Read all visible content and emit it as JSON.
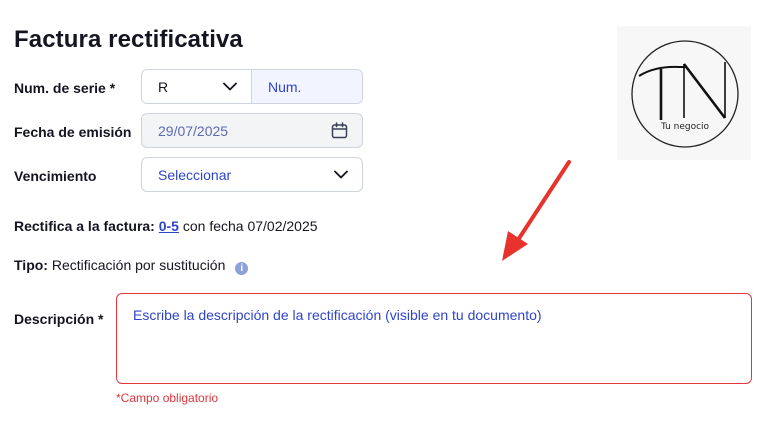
{
  "page": {
    "title": "Factura rectificativa"
  },
  "form": {
    "serie": {
      "label": "Num. de serie *",
      "selected": "R",
      "num_placeholder": "Num."
    },
    "fecha": {
      "label": "Fecha de emisión",
      "value": "29/07/2025"
    },
    "vencimiento": {
      "label": "Vencimiento",
      "selected": "Seleccionar"
    },
    "rectifica": {
      "prefix": "Rectifica a la factura:",
      "invoice_link": "0-5",
      "suffix": "con fecha 07/02/2025"
    },
    "tipo": {
      "label": "Tipo:",
      "value": "Rectificación por sustitución",
      "info_icon": "i"
    },
    "descripcion": {
      "label": "Descripción *",
      "placeholder": "Escribe la descripción de la rectificación (visible en tu documento)",
      "error": "*Campo obligatorio"
    }
  },
  "logo": {
    "letters": "TN",
    "tagline": "Tu negocio"
  },
  "colors": {
    "accent": "#2f45c9",
    "error": "#e0363c",
    "annotation_arrow": "#e8332d"
  }
}
